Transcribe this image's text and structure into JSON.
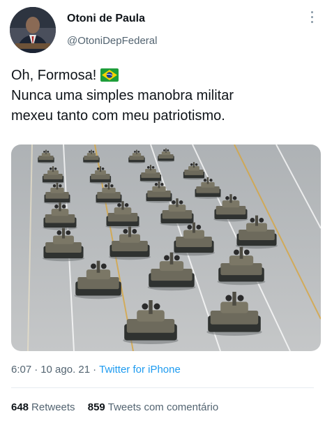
{
  "user": {
    "name": "Otoni de Paula",
    "handle": "@OtoniDepFederal"
  },
  "tweet": {
    "line1": "Oh, Formosa!",
    "line2": "Nunca uma simples manobra militar\nmexeu tanto com meu patriotismo."
  },
  "meta": {
    "time": "6:07",
    "date": "10 ago. 21",
    "separator": "·",
    "app": "Twitter for iPhone"
  },
  "stats": {
    "retweets_count": "648",
    "retweets_label": "Retweets",
    "comments_count": "859",
    "comments_label": "Tweets com comentário"
  },
  "icons": {
    "flag": "brazil-flag-icon",
    "more": "more-vertical-icon"
  }
}
